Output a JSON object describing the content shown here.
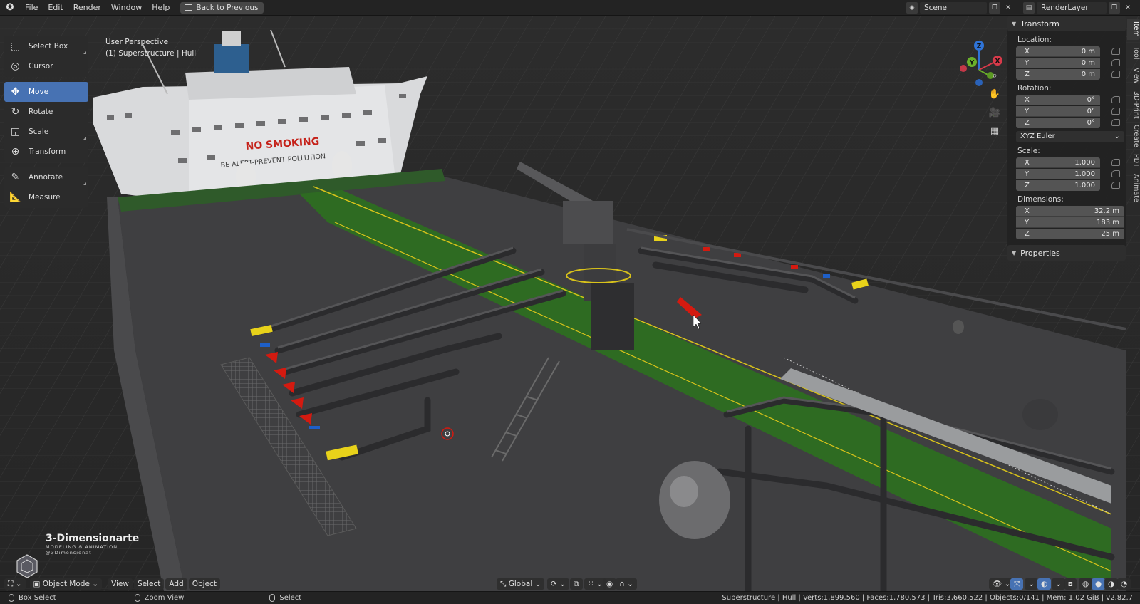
{
  "menu": {
    "logo": "blender-icon",
    "items": [
      "File",
      "Edit",
      "Render",
      "Window",
      "Help"
    ],
    "back_button": "Back to Previous"
  },
  "scene": {
    "name": "Scene",
    "render_layer": "RenderLayer"
  },
  "toolbar": {
    "groups": [
      [
        {
          "label": "Select Box",
          "icon": "select-box-icon",
          "active": false
        },
        {
          "label": "Cursor",
          "icon": "cursor-icon",
          "active": false
        }
      ],
      [
        {
          "label": "Move",
          "icon": "move-icon",
          "active": true
        },
        {
          "label": "Rotate",
          "icon": "rotate-icon",
          "active": false
        },
        {
          "label": "Scale",
          "icon": "scale-icon",
          "active": false
        },
        {
          "label": "Transform",
          "icon": "transform-icon",
          "active": false
        }
      ],
      [
        {
          "label": "Annotate",
          "icon": "annotate-icon",
          "active": false
        },
        {
          "label": "Measure",
          "icon": "measure-icon",
          "active": false
        }
      ]
    ]
  },
  "viewport": {
    "perspective": "User Perspective",
    "object": "(1) Superstructure | Hull",
    "sign_main": "NO SMOKING",
    "sign_sub": "BE ALERT-PREVENT POLLUTION"
  },
  "gizmo": {
    "x": "X",
    "y": "Y",
    "z": "Z"
  },
  "npanel": {
    "transform_title": "Transform",
    "location_label": "Location:",
    "location": [
      {
        "axis": "X",
        "value": "0 m"
      },
      {
        "axis": "Y",
        "value": "0 m"
      },
      {
        "axis": "Z",
        "value": "0 m"
      }
    ],
    "rotation_label": "Rotation:",
    "rotation": [
      {
        "axis": "X",
        "value": "0°"
      },
      {
        "axis": "Y",
        "value": "0°"
      },
      {
        "axis": "Z",
        "value": "0°"
      }
    ],
    "rotation_mode": "XYZ Euler",
    "scale_label": "Scale:",
    "scale": [
      {
        "axis": "X",
        "value": "1.000"
      },
      {
        "axis": "Y",
        "value": "1.000"
      },
      {
        "axis": "Z",
        "value": "1.000"
      }
    ],
    "dimensions_label": "Dimensions:",
    "dimensions": [
      {
        "axis": "X",
        "value": "32.2 m"
      },
      {
        "axis": "Y",
        "value": "183 m"
      },
      {
        "axis": "Z",
        "value": "25 m"
      }
    ],
    "properties_title": "Properties"
  },
  "side_tabs": [
    "Item",
    "Tool",
    "View",
    "3D-Print",
    "Create",
    "PDT",
    "Animate"
  ],
  "header": {
    "mode": "Object Mode",
    "menus": [
      "View",
      "Select",
      "Add",
      "Object"
    ],
    "orientation": "Global"
  },
  "status": {
    "left1": "Box Select",
    "left2": "Zoom View",
    "left3": "Select",
    "stats": "Superstructure | Hull | Verts:1,899,560 | Faces:1,780,573 | Tris:3,660,522 | Objects:0/141 | Mem: 1.02 GiB | v2.82.7"
  },
  "watermark": {
    "title": "3-Dimensionarte",
    "sub1": "MODELING & ANIMATION",
    "sub2": "@3Dimensionat"
  },
  "colors": {
    "accent": "#4772b3",
    "deck_green": "#2e6b22",
    "pipe_grey": "#3b3b3d",
    "caution_yellow": "#e8d21a",
    "valve_red": "#d41a10"
  }
}
